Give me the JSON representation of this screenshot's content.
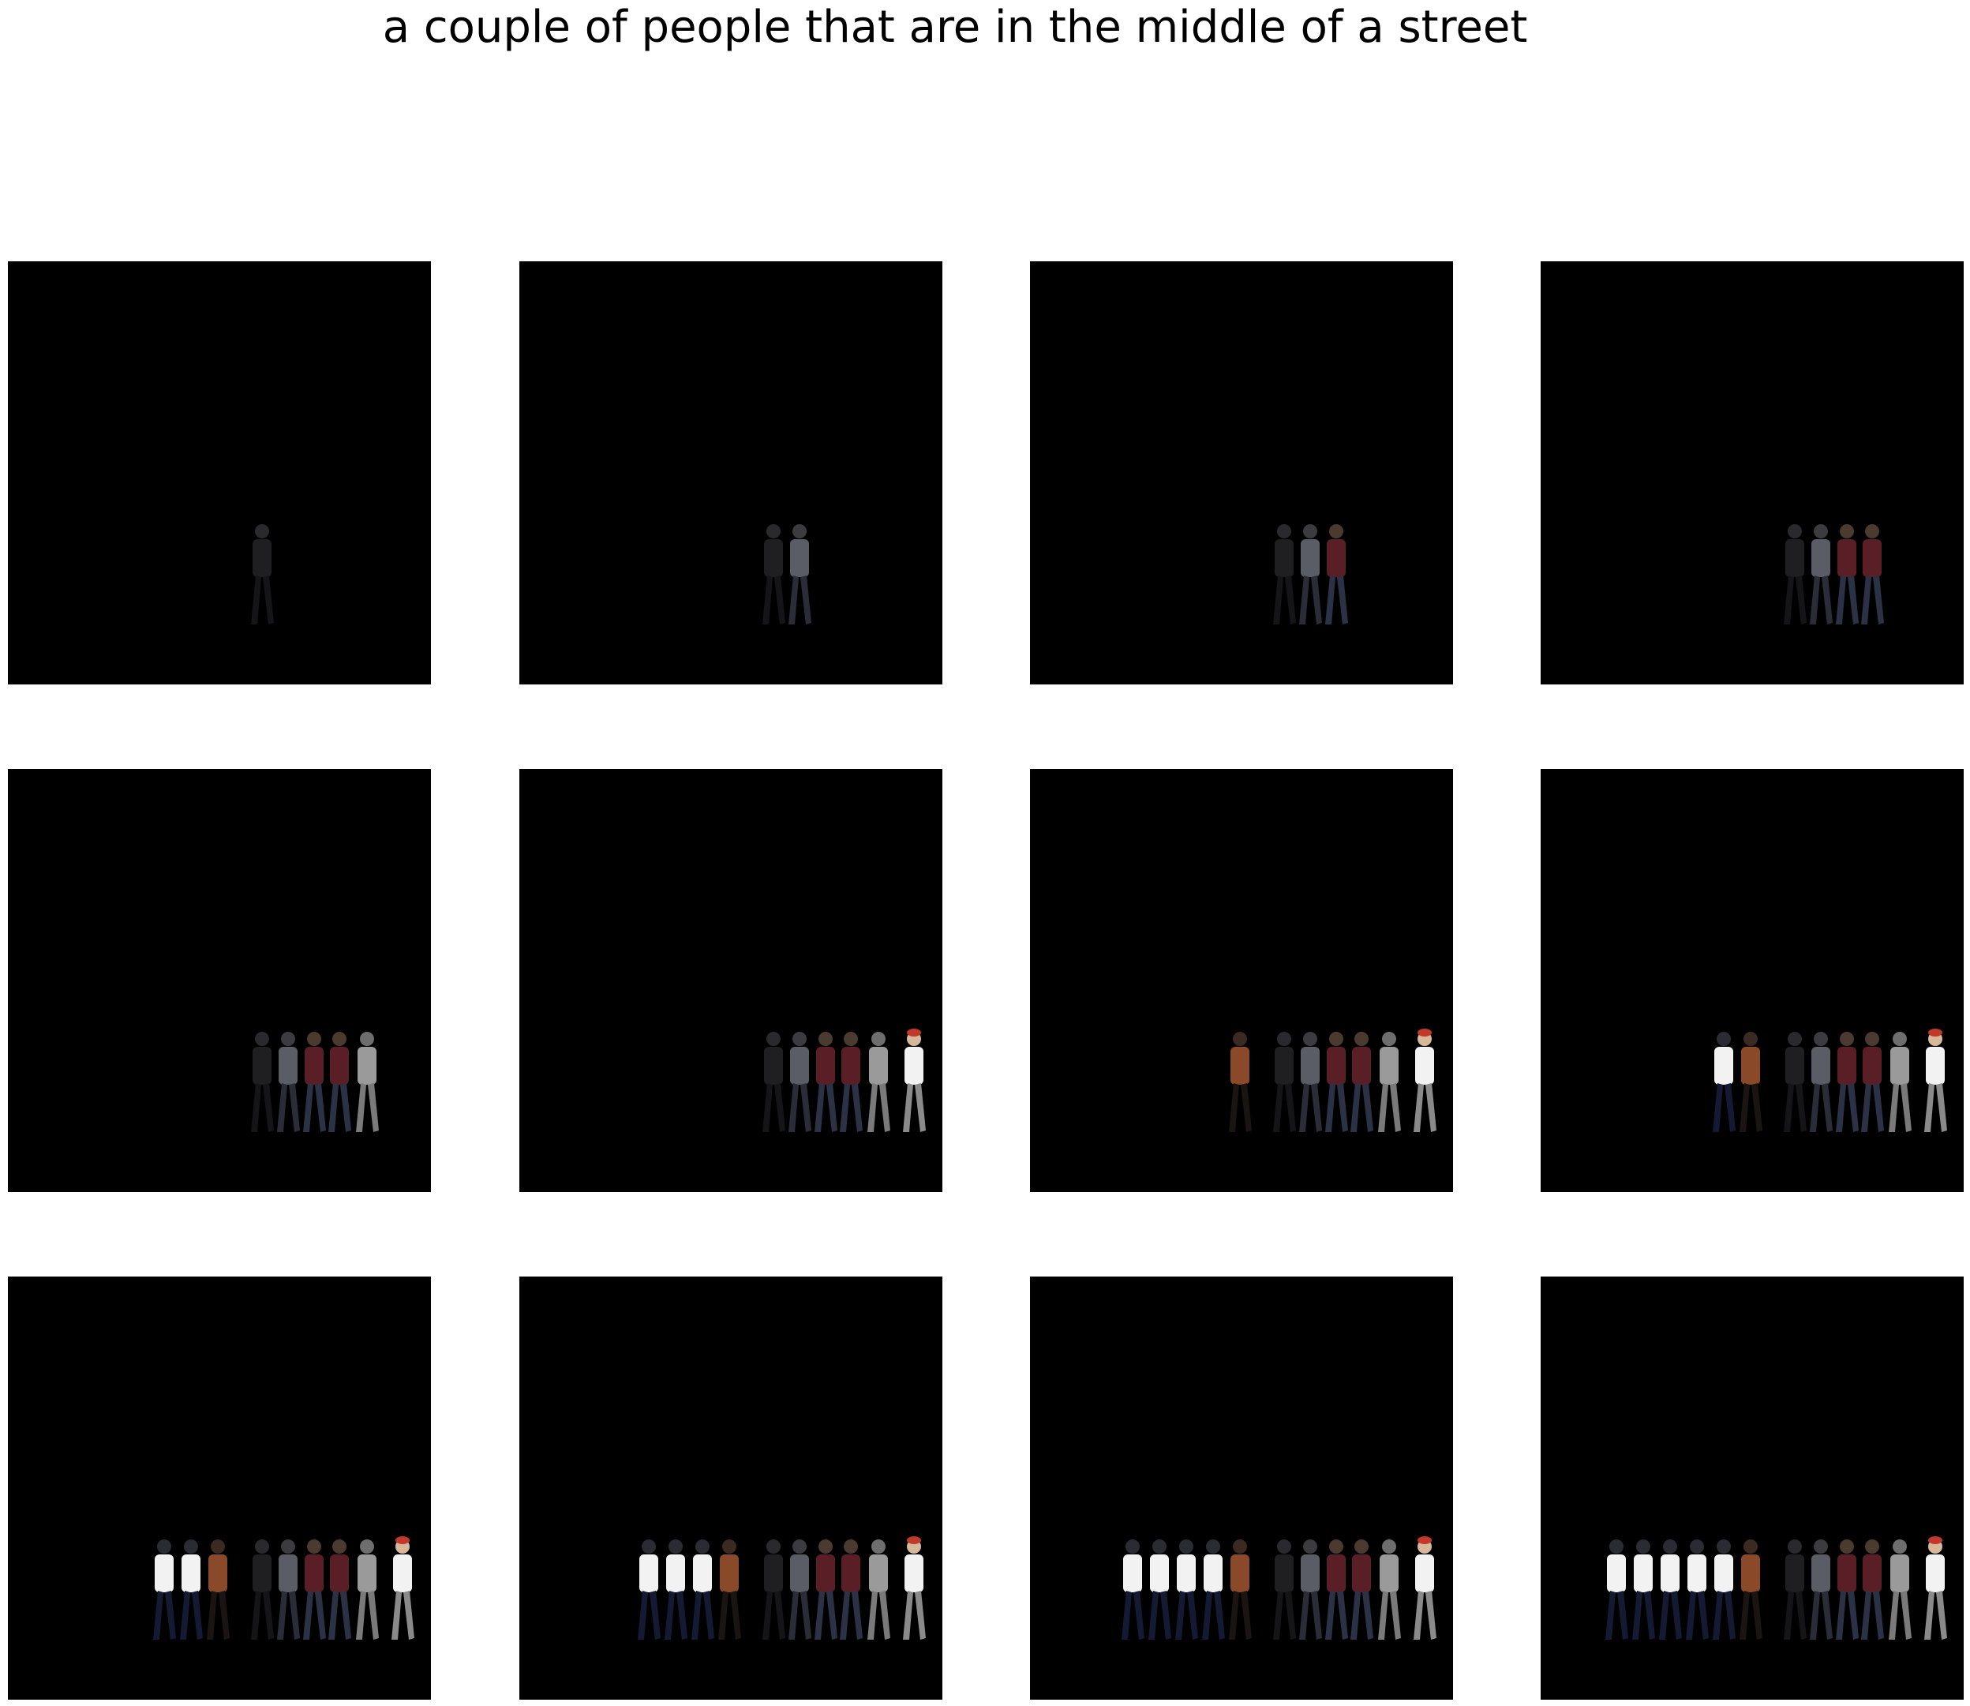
{
  "title": "a couple of people that are in the middle of a street",
  "grid": {
    "rows": 3,
    "cols": 4,
    "panel_background": "#000000",
    "page_background": "#ffffff"
  },
  "figure_palette": {
    "dark": "#1f1f22",
    "grey_shirt": "#5a5d66",
    "maroon": "#5a1f26",
    "light_grey": "#9a9a9a",
    "white": "#f2f2f2",
    "brown": "#8a4a2a",
    "jeans": "#2b3246",
    "red_cap": "#c0392b"
  },
  "panels": [
    {
      "frame": 1,
      "figures": [
        "dark"
      ]
    },
    {
      "frame": 2,
      "figures": [
        "dark",
        "grey_shirt"
      ]
    },
    {
      "frame": 3,
      "figures": [
        "dark",
        "grey_shirt",
        "maroon"
      ]
    },
    {
      "frame": 4,
      "figures": [
        "dark",
        "grey_shirt",
        "maroon",
        "maroon"
      ]
    },
    {
      "frame": 5,
      "figures": [
        "dark",
        "grey_shirt",
        "maroon",
        "maroon",
        "light_grey"
      ]
    },
    {
      "frame": 6,
      "figures": [
        "dark",
        "grey_shirt",
        "maroon",
        "maroon",
        "light_grey",
        "white_cap"
      ]
    },
    {
      "frame": 7,
      "figures": [
        "brown",
        "dark",
        "grey_shirt",
        "maroon",
        "maroon",
        "light_grey",
        "white_cap"
      ]
    },
    {
      "frame": 8,
      "figures": [
        "white",
        "brown",
        "dark",
        "grey_shirt",
        "maroon",
        "maroon",
        "light_grey",
        "white_cap"
      ]
    },
    {
      "frame": 9,
      "figures": [
        "white",
        "white",
        "brown",
        "dark",
        "grey_shirt",
        "maroon",
        "maroon",
        "light_grey",
        "white_cap"
      ]
    },
    {
      "frame": 10,
      "figures": [
        "white",
        "white",
        "white",
        "brown",
        "dark",
        "grey_shirt",
        "maroon",
        "maroon",
        "light_grey",
        "white_cap"
      ]
    },
    {
      "frame": 11,
      "figures": [
        "white",
        "white",
        "white",
        "white",
        "brown",
        "dark",
        "grey_shirt",
        "maroon",
        "maroon",
        "light_grey",
        "white_cap"
      ]
    },
    {
      "frame": 12,
      "figures": [
        "white",
        "white",
        "white",
        "white",
        "white",
        "brown",
        "dark",
        "grey_shirt",
        "maroon",
        "maroon",
        "light_grey",
        "white_cap"
      ]
    }
  ]
}
